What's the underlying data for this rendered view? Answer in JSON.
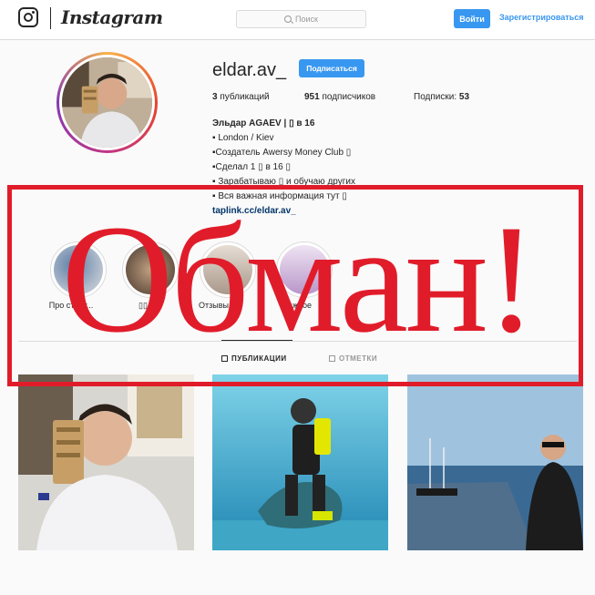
{
  "header": {
    "logo_icon": "instagram-glyph-icon",
    "wordmark": "Instagram",
    "search_placeholder": "Поиск",
    "login_label": "Войти",
    "signup_label": "Зарегистрироваться"
  },
  "profile": {
    "username": "eldar.av_",
    "follow_label": "Подписаться",
    "posts_count": "3",
    "posts_label": "публикаций",
    "followers_count": "951",
    "followers_label": "подписчиков",
    "following_label": "Подписки:",
    "following_count": "53",
    "bio": [
      "Эльдар AGAEV | ▯ в 16",
      "▪ London / Kiev",
      "▪Создатель Awersy Money Club ▯",
      "▪Сделал 1 ▯ в 16 ▯",
      "▪ Зарабатываю ▯ и обучаю других",
      "▪ Вся важная информация тут ▯"
    ],
    "link": "taplink.cc/eldar.av_"
  },
  "highlights": [
    {
      "label": "Про стару...",
      "color": "#b9c3cf"
    },
    {
      "label": "▯▯",
      "color": "#8d7a68"
    },
    {
      "label": "Отзывы 1...",
      "color": "#c9bfb6"
    },
    {
      "label": "Важное",
      "color": "#d6c6e0"
    }
  ],
  "tabs": [
    {
      "label": "ПУБЛИКАЦИИ",
      "active": true
    },
    {
      "label": "ОТМЕТКИ",
      "active": false
    }
  ],
  "overlay": {
    "stamp_text": "Обман!",
    "color": "#e11c2a"
  },
  "colors": {
    "accent": "#3897f0",
    "link": "#003569",
    "border": "#dbdbdb"
  }
}
